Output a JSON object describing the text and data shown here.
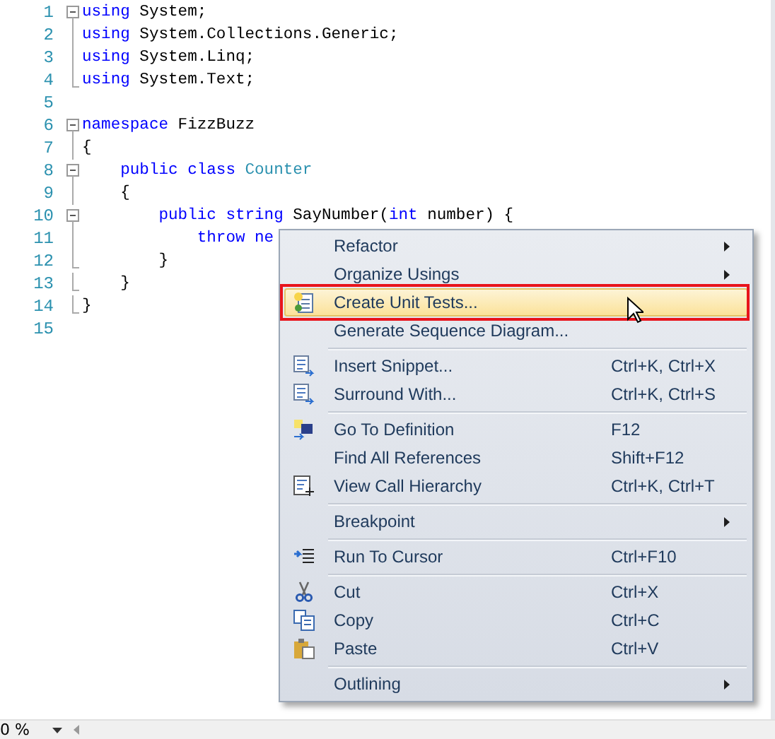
{
  "editor": {
    "lines": [
      {
        "number": "1",
        "kind": "fold-start",
        "tokens": [
          {
            "kind": "keyword",
            "text": "using"
          },
          {
            "kind": "plain",
            "text": " System;"
          }
        ]
      },
      {
        "number": "2",
        "kind": "fold-inner",
        "tokens": [
          {
            "kind": "keyword",
            "text": "using"
          },
          {
            "kind": "plain",
            "text": " System.Collections.Generic;"
          }
        ]
      },
      {
        "number": "3",
        "kind": "fold-inner",
        "tokens": [
          {
            "kind": "keyword",
            "text": "using"
          },
          {
            "kind": "plain",
            "text": " System.Linq;"
          }
        ]
      },
      {
        "number": "4",
        "kind": "fold-end",
        "tokens": [
          {
            "kind": "keyword",
            "text": "using"
          },
          {
            "kind": "plain",
            "text": " System.Text;"
          }
        ]
      },
      {
        "number": "5",
        "kind": "plain"
      },
      {
        "number": "6",
        "kind": "fold-start",
        "tokens": [
          {
            "kind": "keyword",
            "text": "namespace"
          },
          {
            "kind": "plain",
            "text": " FizzBuzz"
          }
        ]
      },
      {
        "number": "7",
        "kind": "fold-inner",
        "tokens": [
          {
            "kind": "plain",
            "text": "{"
          }
        ]
      },
      {
        "number": "8",
        "kind": "fold-start",
        "tokens": [
          {
            "kind": "keyword",
            "text": "    public class"
          },
          {
            "kind": "type",
            "text": " Counter"
          }
        ]
      },
      {
        "number": "9",
        "kind": "fold-inner",
        "tokens": [
          {
            "kind": "plain",
            "text": "    {"
          }
        ]
      },
      {
        "number": "10",
        "kind": "fold-start",
        "tokens": [
          {
            "kind": "keyword",
            "text": "        public string"
          },
          {
            "kind": "plain",
            "text": " SayNumber("
          },
          {
            "kind": "keyword",
            "text": "int"
          },
          {
            "kind": "plain",
            "text": " number) {"
          }
        ]
      },
      {
        "number": "11",
        "kind": "fold-inner",
        "tokens": [
          {
            "kind": "keyword",
            "text": "            throw ne"
          }
        ]
      },
      {
        "number": "12",
        "kind": "fold-end",
        "tokens": [
          {
            "kind": "plain",
            "text": "        }"
          }
        ]
      },
      {
        "number": "13",
        "kind": "fold-end",
        "tokens": [
          {
            "kind": "plain",
            "text": "    }"
          }
        ]
      },
      {
        "number": "14",
        "kind": "fold-end",
        "tokens": [
          {
            "kind": "plain",
            "text": "}"
          }
        ]
      },
      {
        "number": "15",
        "kind": "plain"
      }
    ]
  },
  "context_menu": {
    "items": [
      {
        "kind": "item",
        "label": "Refactor",
        "submenu": true,
        "selected": false
      },
      {
        "kind": "item",
        "label": "Organize Usings",
        "submenu": true,
        "selected": false
      },
      {
        "kind": "item",
        "label": "Create Unit Tests...",
        "submenu": false,
        "selected": true
      },
      {
        "kind": "item",
        "label": "Generate Sequence Diagram...",
        "submenu": false,
        "selected": false
      },
      {
        "kind": "separator"
      },
      {
        "kind": "item",
        "label": "Insert Snippet...",
        "shortcut": "Ctrl+K, Ctrl+X",
        "submenu": false,
        "selected": false
      },
      {
        "kind": "item",
        "label": "Surround With...",
        "shortcut": "Ctrl+K, Ctrl+S",
        "submenu": false,
        "selected": false
      },
      {
        "kind": "separator"
      },
      {
        "kind": "item",
        "label": "Go To Definition",
        "shortcut": "F12",
        "submenu": false,
        "selected": false
      },
      {
        "kind": "item",
        "label": "Find All References",
        "shortcut": "Shift+F12",
        "submenu": false,
        "selected": false
      },
      {
        "kind": "item",
        "label": "View Call Hierarchy",
        "shortcut": "Ctrl+K, Ctrl+T",
        "submenu": false,
        "selected": false
      },
      {
        "kind": "separator"
      },
      {
        "kind": "item",
        "label": "Breakpoint",
        "submenu": true,
        "selected": false
      },
      {
        "kind": "separator"
      },
      {
        "kind": "item",
        "label": "Run To Cursor",
        "shortcut": "Ctrl+F10",
        "submenu": false,
        "selected": false
      },
      {
        "kind": "separator"
      },
      {
        "kind": "item",
        "label": "Cut",
        "shortcut": "Ctrl+X",
        "submenu": false,
        "selected": false
      },
      {
        "kind": "item",
        "label": "Copy",
        "shortcut": "Ctrl+C",
        "submenu": false,
        "selected": false
      },
      {
        "kind": "item",
        "label": "Paste",
        "shortcut": "Ctrl+V",
        "submenu": false,
        "selected": false
      },
      {
        "kind": "separator"
      },
      {
        "kind": "item",
        "label": "Outlining",
        "submenu": true,
        "selected": false
      }
    ]
  },
  "status_bar": {
    "zoom": "0 %"
  }
}
